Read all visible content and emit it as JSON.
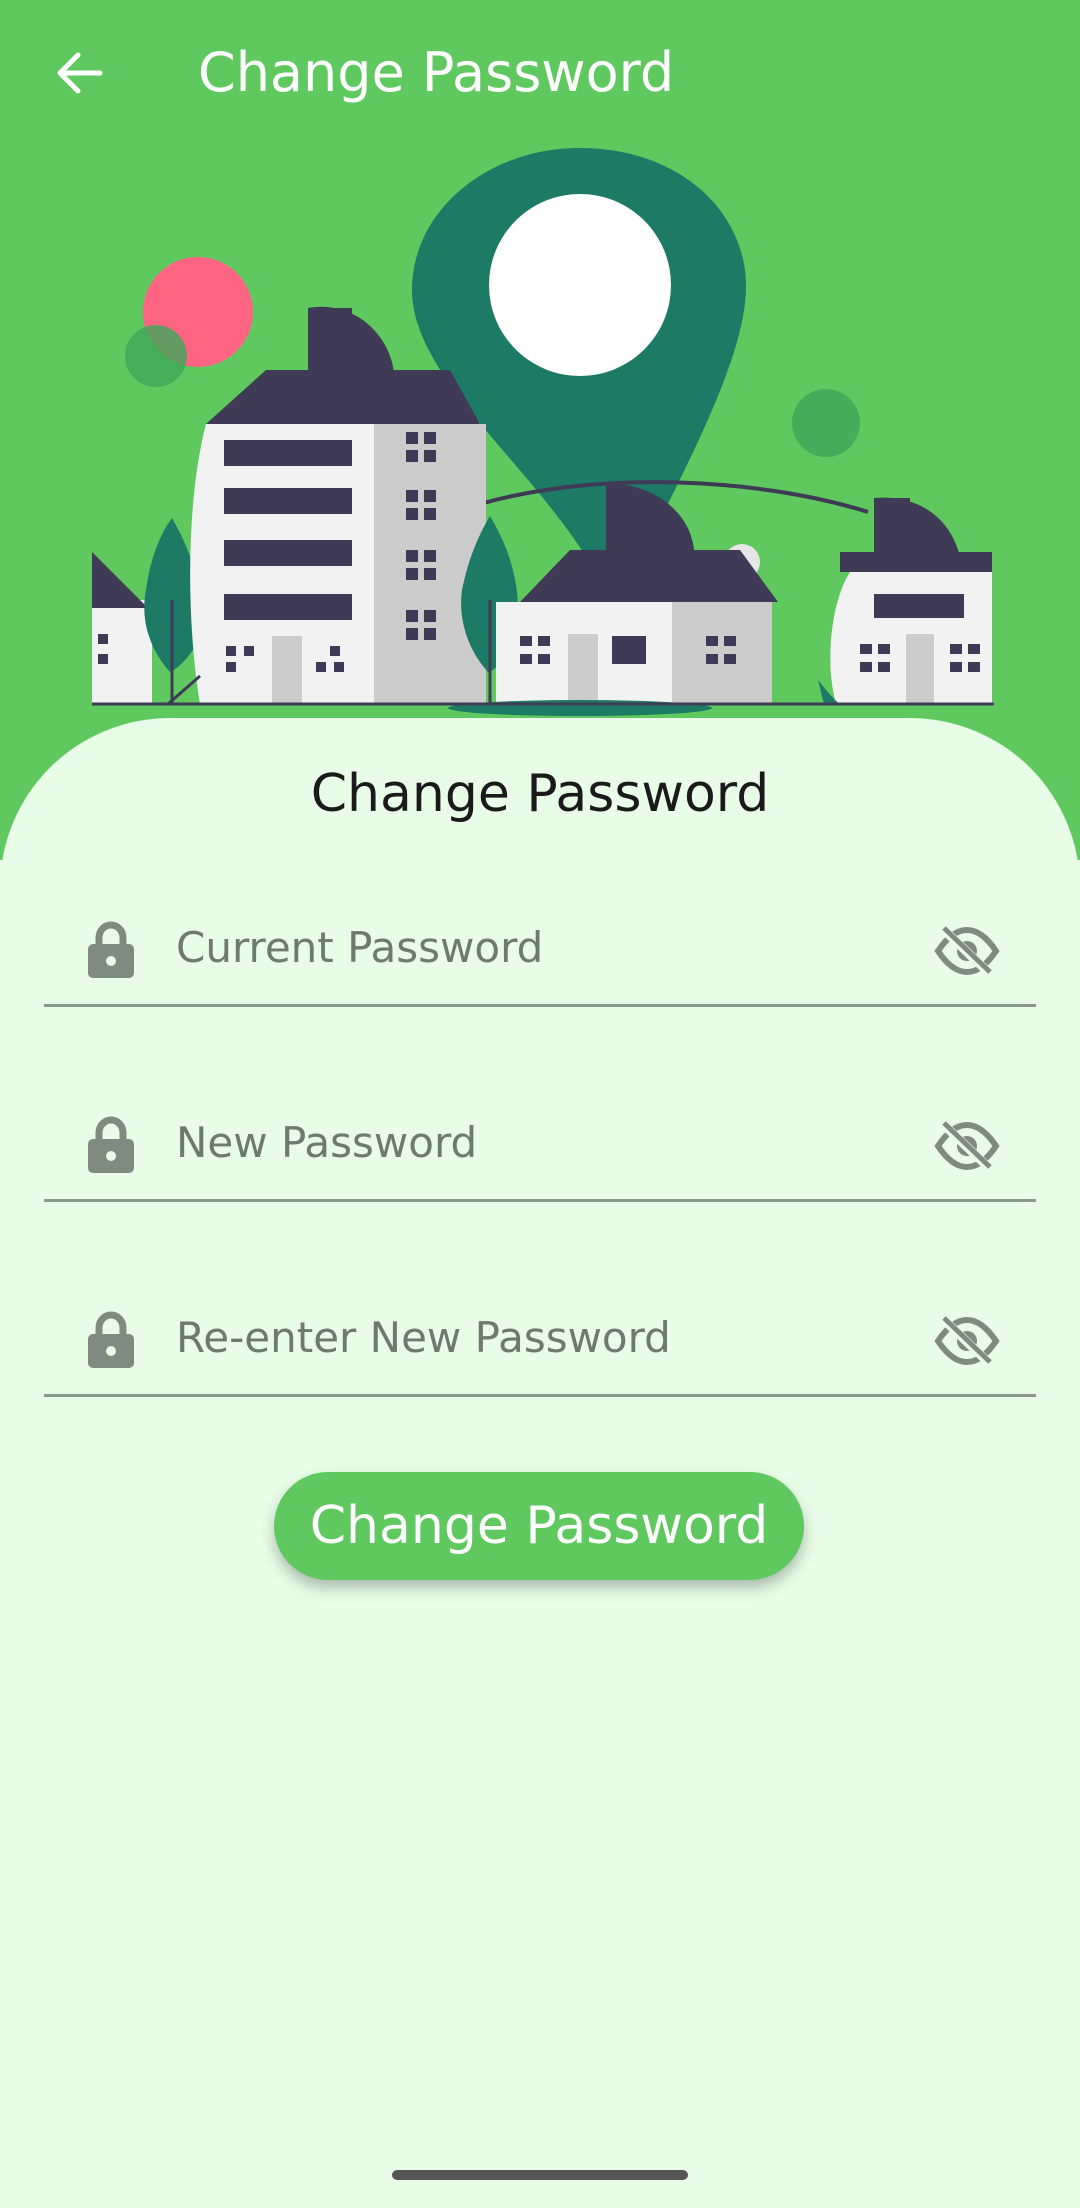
{
  "app_bar": {
    "title": "Change Password",
    "back_icon": "arrow-left-icon"
  },
  "illustration": {
    "description_icon": "city-location-illustration",
    "colors": {
      "background": "#5fc95f",
      "pin": "#1d7a64",
      "roof": "#3f3a55",
      "wall": "#f2f2f2",
      "wall_shade": "#cccccc",
      "sun": "#ff6583"
    }
  },
  "form": {
    "title": "Change Password",
    "fields": [
      {
        "placeholder": "Current Password",
        "lock_icon": "lock-icon",
        "toggle_icon": "eye-off-icon"
      },
      {
        "placeholder": "New Password",
        "lock_icon": "lock-icon",
        "toggle_icon": "eye-off-icon"
      },
      {
        "placeholder": "Re-enter New Password",
        "lock_icon": "lock-icon",
        "toggle_icon": "eye-off-icon"
      }
    ],
    "submit_label": "Change Password"
  },
  "colors": {
    "accent": "#5fc95f",
    "sheet_background": "#e8fce8"
  }
}
